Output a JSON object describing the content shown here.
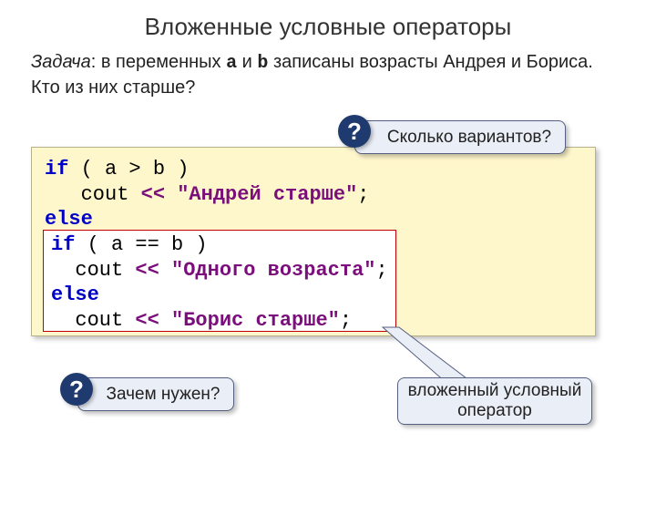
{
  "title": "Вложенные условные операторы",
  "task": {
    "zadacha": "Задача",
    "text_before_a": ": в переменных ",
    "var_a": "a",
    "between_ab": " и ",
    "var_b": "b",
    "text_after_b": " записаны возрасты Андрея и Бориса. Кто из них старше?"
  },
  "code_outer": {
    "kw_if": "if",
    "cond1": " ( a > b )",
    "cout1a": "   cout ",
    "op1": "<<",
    "str1": " \"Андрей старше\"",
    "semi1": ";",
    "kw_else": "else"
  },
  "code_inner": {
    "kw_if": "if",
    "cond2": " ( a == b )",
    "cout2a": "  cout ",
    "op2": "<<",
    "str2": " \"Одного возраста\"",
    "semi2": ";",
    "kw_else": "else",
    "cout3a": "  cout ",
    "op3": "<<",
    "str3": " \"Борис старше\"",
    "semi3": ";"
  },
  "callouts": {
    "variants": "Сколько вариантов?",
    "why": "Зачем нужен?",
    "nested": "вложенный условный оператор"
  },
  "badge": "?"
}
